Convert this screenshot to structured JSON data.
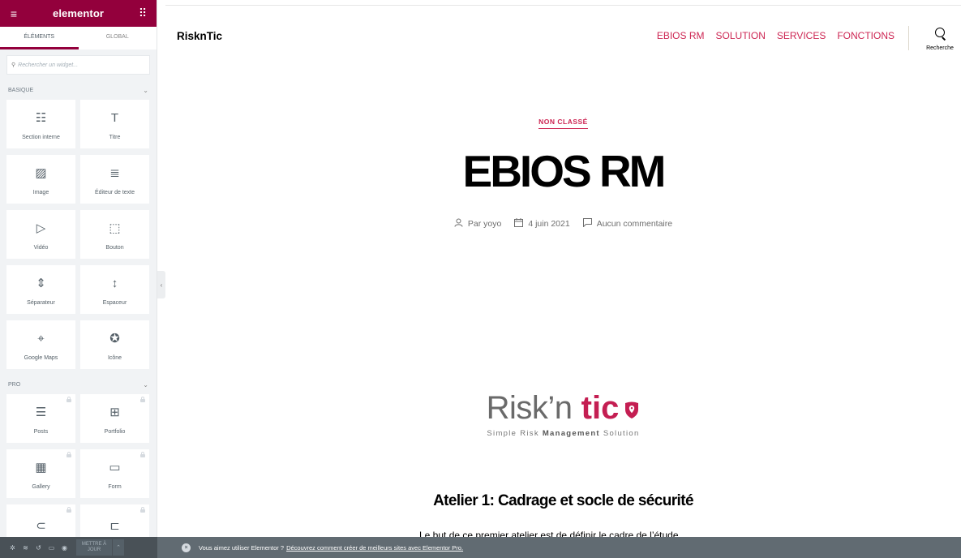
{
  "panel": {
    "brand": "elementor",
    "tabs": [
      "ÉLÉMENTS",
      "GLOBAL"
    ],
    "search_placeholder": "Rechercher un widget...",
    "categories": [
      {
        "title": "BASIQUE",
        "widgets": [
          {
            "label": "Section interne",
            "icon": "columns-icon",
            "glyph": "☷"
          },
          {
            "label": "Titre",
            "icon": "heading-icon",
            "glyph": "T"
          },
          {
            "label": "Image",
            "icon": "image-icon",
            "glyph": "▨"
          },
          {
            "label": "Éditeur de texte",
            "icon": "text-editor-icon",
            "glyph": "≣"
          },
          {
            "label": "Vidéo",
            "icon": "video-icon",
            "glyph": "▷"
          },
          {
            "label": "Bouton",
            "icon": "button-icon",
            "glyph": "⬚"
          },
          {
            "label": "Séparateur",
            "icon": "divider-icon",
            "glyph": "⇕"
          },
          {
            "label": "Espaceur",
            "icon": "spacer-icon",
            "glyph": "↕"
          },
          {
            "label": "Google Maps",
            "icon": "map-icon",
            "glyph": "⌖"
          },
          {
            "label": "Icône",
            "icon": "star-icon",
            "glyph": "✪"
          }
        ]
      },
      {
        "title": "PRO",
        "widgets": [
          {
            "label": "Posts",
            "icon": "posts-icon",
            "glyph": "☰",
            "locked": true
          },
          {
            "label": "Portfolio",
            "icon": "portfolio-icon",
            "glyph": "⊞",
            "locked": true
          },
          {
            "label": "Gallery",
            "icon": "gallery-icon",
            "glyph": "▦",
            "locked": true
          },
          {
            "label": "Form",
            "icon": "form-icon",
            "glyph": "▭",
            "locked": true
          },
          {
            "label": "",
            "icon": "login-icon",
            "glyph": "⊂",
            "locked": true
          },
          {
            "label": "",
            "icon": "slides-icon",
            "glyph": "⊏",
            "locked": true
          }
        ]
      }
    ],
    "footer": {
      "update_label_1": "METTRE À",
      "update_label_2": "JOUR"
    }
  },
  "promo": {
    "text": "Vous aimez utiliser Elementor ?",
    "link": "Découvrez comment créer de meilleurs sites avec Elementor Pro."
  },
  "site": {
    "logo": "RisknTic",
    "nav": [
      "EBIOS RM",
      "SOLUTION",
      "SERVICES",
      "FONCTIONS"
    ],
    "search_label": "Recherche",
    "category": "NON CLASSÉ",
    "title": "EBIOS RM",
    "meta": {
      "author": "Par yoyo",
      "date": "4 juin 2021",
      "comments": "Aucun commentaire"
    },
    "logo_image": {
      "risk": "Risk’n",
      "tic": "tic",
      "tagline_pre": "Simple Risk ",
      "tagline_bold": "Management",
      "tagline_post": " Solution"
    },
    "section_heading": "Atelier 1: Cadrage et socle de sécurité",
    "body_text": "Le but de ce premier atelier est de définir le cadre de l’étude"
  },
  "colors": {
    "elementor_brand": "#93003c",
    "accent": "#cd2653",
    "logo_red": "#c41e52"
  }
}
